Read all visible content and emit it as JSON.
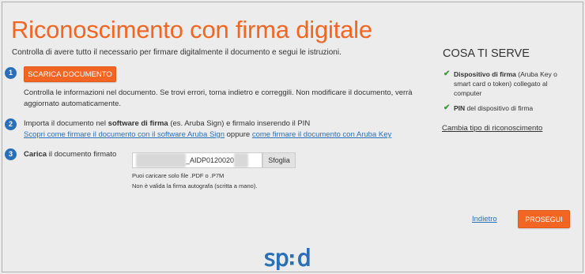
{
  "title": "Riconoscimento con firma digitale",
  "intro": "Controlla di avere tutto il necessario per firmare digitalmente il documento e segui le istruzioni.",
  "steps": {
    "s1": {
      "num": "1",
      "button": "SCARICA DOCUMENTO",
      "desc_line1": "Controlla le informazioni nel documento. Se trovi errori, torna indietro e correggili. Non modificare il documento, verrà",
      "desc_line2": "aggiornato automaticamente."
    },
    "s2": {
      "num": "2",
      "pre": "Importa il documento nel ",
      "bold": "software di firma",
      "post": " (es. Aruba Sign) e firmalo inserendo il PIN",
      "link1": "Scopri come firmare il documento con il software Aruba Sign",
      "oppure": " oppure ",
      "link2": "come firmare il documento con Aruba Key"
    },
    "s3": {
      "num": "3",
      "bold": "Carica",
      "rest": " il documento firmato",
      "file_prefix_hidden": "xxxxxxxxxxxxxx",
      "file_name": "_AIDP0120020",
      "file_suffix_hidden": "xxxx",
      "browse": "Sfoglia",
      "note1": "Puoi caricare solo file .PDF o .P7M",
      "note2": "Non è valida la firma autografa (scritta a mano)."
    }
  },
  "sidebar": {
    "title": "COSA TI SERVE",
    "item1_bold": "Dispositivo di firma",
    "item1_rest_l1": " (Aruba Key o",
    "item1_l2": "smart card o token) collegato al",
    "item1_l3": "computer",
    "item2_bold": "PIN",
    "item2_rest": " del dispositivo di firma",
    "change_link": "Cambia tipo di riconoscimento",
    "check_symbol": "✔"
  },
  "footer": {
    "back": "Indietro",
    "next": "PROSEGUI"
  },
  "colors": {
    "accent": "#f26522",
    "link": "#2b6fb6",
    "check": "#3a9a3a",
    "logo": "#2b6fb6"
  }
}
